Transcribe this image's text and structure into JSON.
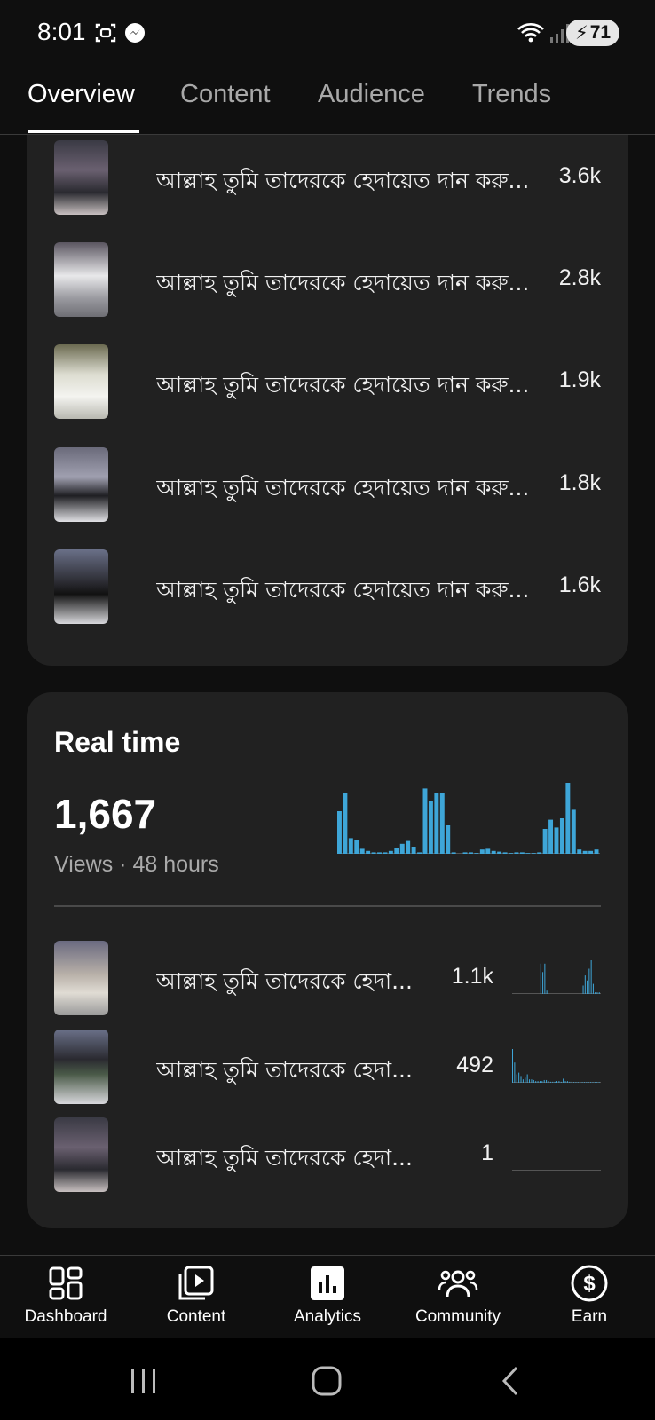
{
  "status_bar": {
    "time": "8:01",
    "battery": "71"
  },
  "tabs": [
    {
      "label": "Overview",
      "active": true
    },
    {
      "label": "Content",
      "active": false
    },
    {
      "label": "Audience",
      "active": false
    },
    {
      "label": "Trends",
      "active": false
    }
  ],
  "top_content": {
    "rows": [
      {
        "title": "আল্লাহ তুমি তাদেরকে হেদায়েত  দান করু...",
        "value": "3.6k"
      },
      {
        "title": "আল্লাহ তুমি তাদেরকে হেদায়েত  দান করু...",
        "value": "2.8k"
      },
      {
        "title": "আল্লাহ তুমি তাদেরকে হেদায়েত  দান করু...",
        "value": "1.9k"
      },
      {
        "title": "আল্লাহ তুমি তাদেরকে হেদায়েত  দান করু...",
        "value": "1.8k"
      },
      {
        "title": "আল্লাহ তুমি তাদেরকে হেদায়েত  দান করু...",
        "value": "1.6k"
      }
    ]
  },
  "realtime": {
    "title": "Real time",
    "count": "1,667",
    "subtitle": "Views · 48 hours",
    "bars": [
      0.6,
      0.85,
      0.22,
      0.2,
      0.07,
      0.04,
      0.02,
      0.02,
      0.02,
      0.04,
      0.08,
      0.14,
      0.18,
      0.1,
      0.02,
      0.92,
      0.75,
      0.86,
      0.86,
      0.4,
      0.02,
      0.0,
      0.02,
      0.02,
      0.01,
      0.06,
      0.07,
      0.04,
      0.03,
      0.02,
      0.01,
      0.02,
      0.02,
      0.01,
      0.01,
      0.02,
      0.35,
      0.48,
      0.37,
      0.5,
      1.0,
      0.62,
      0.06,
      0.04,
      0.04,
      0.06
    ],
    "rows": [
      {
        "title": "আল্লাহ তুমি তাদেরকে হেদা...",
        "value": "1.1k",
        "spark": [
          0,
          0,
          0,
          0,
          0,
          0,
          0,
          0,
          0,
          0,
          0,
          0,
          0,
          0,
          0.9,
          0.65,
          0.9,
          0.1,
          0,
          0,
          0,
          0,
          0,
          0,
          0,
          0,
          0,
          0,
          0,
          0,
          0,
          0,
          0,
          0,
          0,
          0.25,
          0.55,
          0.4,
          0.75,
          1.0,
          0.3,
          0.05,
          0.05,
          0.05
        ]
      },
      {
        "title": "আল্লাহ তুমি তাদেরকে হেদা...",
        "value": "492",
        "spark": [
          1.0,
          0.6,
          0.25,
          0.3,
          0.2,
          0.1,
          0.15,
          0.25,
          0.1,
          0.1,
          0.08,
          0.05,
          0.05,
          0.05,
          0.05,
          0.08,
          0.08,
          0.05,
          0.03,
          0.03,
          0.03,
          0.05,
          0.05,
          0.03,
          0.12,
          0.05,
          0.05,
          0.03,
          0.03,
          0.02,
          0.02,
          0.02,
          0.02,
          0.02,
          0.02,
          0.02,
          0.02,
          0.02,
          0.02,
          0.02,
          0.02,
          0.02
        ]
      },
      {
        "title": "আল্লাহ তুমি তাদেরকে হেদা...",
        "value": "1",
        "spark": []
      }
    ]
  },
  "bottom_nav": [
    {
      "label": "Dashboard",
      "icon": "dashboard-icon"
    },
    {
      "label": "Content",
      "icon": "content-icon"
    },
    {
      "label": "Analytics",
      "icon": "analytics-icon",
      "active": true
    },
    {
      "label": "Community",
      "icon": "community-icon"
    },
    {
      "label": "Earn",
      "icon": "earn-icon"
    }
  ],
  "colors": {
    "accent_bar": "#3ea6d8",
    "card": "#212121",
    "background": "#0f0f0f"
  }
}
